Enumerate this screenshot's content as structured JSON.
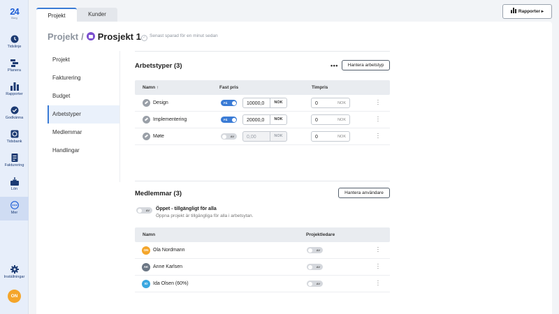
{
  "brand": {
    "number": "24",
    "tagline": "Borg"
  },
  "nav": [
    {
      "label": "Tidslinje",
      "icon": "clock-icon"
    },
    {
      "label": "Planera",
      "icon": "planner-icon"
    },
    {
      "label": "Rapporter",
      "icon": "bar-chart-icon"
    },
    {
      "label": "Godkänna",
      "icon": "check-circle-icon"
    },
    {
      "label": "Tidsbank",
      "icon": "timebank-icon"
    },
    {
      "label": "Fakturering",
      "icon": "invoice-icon"
    },
    {
      "label": "Lön",
      "icon": "payroll-icon"
    },
    {
      "label": "Mer",
      "icon": "more-icon"
    }
  ],
  "settings_label": "Inställningar",
  "user_initials": "ON",
  "tabs": {
    "projekt": "Projekt",
    "kunder": "Kunder"
  },
  "rapporter_button": "Rapporter",
  "breadcrumb": {
    "parent": "Projekt",
    "separator": "/",
    "current": "Prosjekt 1"
  },
  "saved_status": "Senast sparad för en minut sedan",
  "side_menu": [
    "Projekt",
    "Fakturering",
    "Budget",
    "Arbetstyper",
    "Medlemmar",
    "Handlingar"
  ],
  "work_types": {
    "title": "Arbetstyper (3)",
    "more": "•••",
    "manage_button": "Hantera arbetstyp",
    "headers": {
      "name": "Namn",
      "sort": "↑",
      "fixed_price": "Fast pris",
      "hourly": "Timpris"
    },
    "rows": [
      {
        "name": "Design",
        "fixed_on": true,
        "toggle_label": "PÅ",
        "fixed_value": "10000,0",
        "fixed_unit": "NOK",
        "hourly_value": "0",
        "hourly_unit": "NOK"
      },
      {
        "name": "Implementering",
        "fixed_on": true,
        "toggle_label": "PÅ",
        "fixed_value": "20000,0",
        "fixed_unit": "NOK",
        "hourly_value": "0",
        "hourly_unit": "NOK"
      },
      {
        "name": "Møte",
        "fixed_on": false,
        "toggle_label": "AV",
        "fixed_value": "0,00",
        "fixed_unit": "NOK",
        "hourly_value": "0",
        "hourly_unit": "NOK"
      }
    ]
  },
  "members": {
    "title": "Medlemmar (3)",
    "manage_button": "Hantera användare",
    "open_toggle_label": "AV",
    "open_title": "Öppet - tillgängligt för alla",
    "open_desc": "Öppna projekt är tillgängliga för alla i arbetsytan.",
    "headers": {
      "name": "Namn",
      "leader": "Projektledare"
    },
    "rows": [
      {
        "initials": "ON",
        "name": "Ola Nordmann",
        "color": "#f4a52a",
        "leader_label": "AV"
      },
      {
        "initials": "AK",
        "name": "Anne Karlsen",
        "color": "#6b7684",
        "leader_label": "AV"
      },
      {
        "initials": "IO",
        "name": "Ida Olsen (60%)",
        "color": "#3aa7e0",
        "leader_label": "AV"
      }
    ]
  }
}
